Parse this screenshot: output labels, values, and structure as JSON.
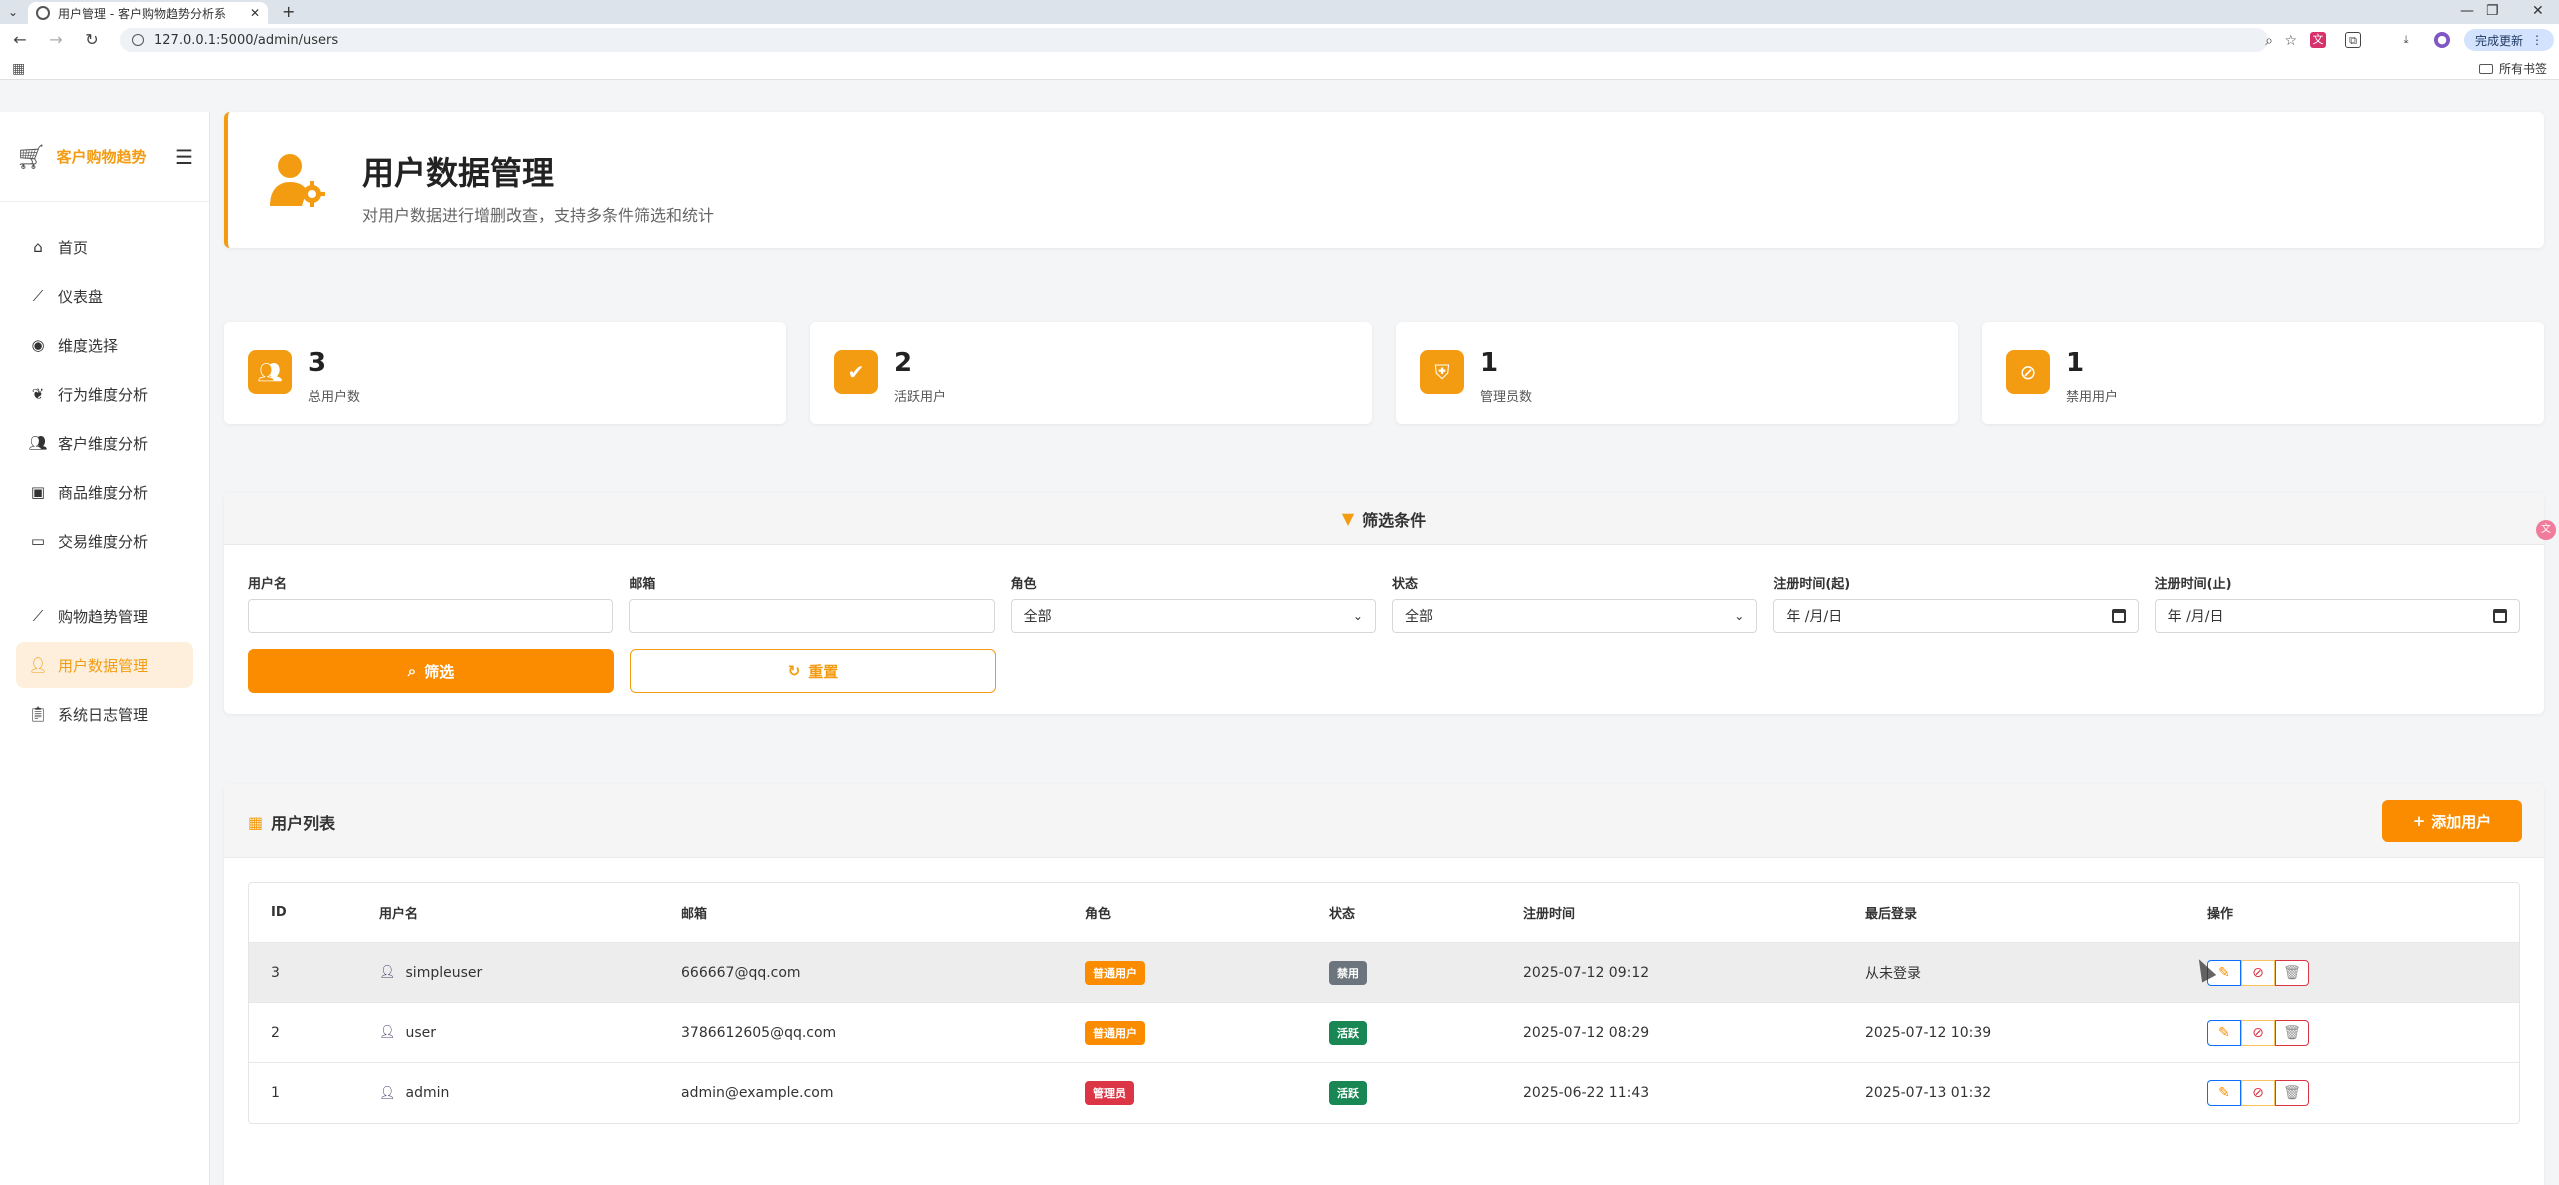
{
  "browser": {
    "tab_title": "用户管理 - 客户购物趋势分析系",
    "url": "127.0.0.1:5000/admin/users",
    "update_label": "完成更新",
    "all_bookmarks": "所有书签"
  },
  "sidebar": {
    "brand": "客户购物趋势",
    "items": [
      {
        "label": "首页",
        "icon": "home-icon"
      },
      {
        "label": "仪表盘",
        "icon": "chart-line-icon"
      },
      {
        "label": "维度选择",
        "icon": "compass-icon"
      },
      {
        "label": "行为维度分析",
        "icon": "brain-icon"
      },
      {
        "label": "客户维度分析",
        "icon": "users-icon"
      },
      {
        "label": "商品维度分析",
        "icon": "box-icon"
      },
      {
        "label": "交易维度分析",
        "icon": "credit-card-icon"
      },
      {
        "label": "购物趋势管理",
        "icon": "chart-line-icon"
      },
      {
        "label": "用户数据管理",
        "icon": "user-gear-icon",
        "active": true
      },
      {
        "label": "系统日志管理",
        "icon": "clipboard-icon"
      }
    ]
  },
  "header": {
    "title": "用户数据管理",
    "subtitle": "对用户数据进行增删改查，支持多条件筛选和统计"
  },
  "stats": [
    {
      "value": "3",
      "label": "总用户数",
      "icon": "users-icon"
    },
    {
      "value": "2",
      "label": "活跃用户",
      "icon": "user-check-icon"
    },
    {
      "value": "1",
      "label": "管理员数",
      "icon": "user-shield-icon"
    },
    {
      "value": "1",
      "label": "禁用用户",
      "icon": "user-slash-icon"
    }
  ],
  "filter": {
    "title": "筛选条件",
    "fields": {
      "username_label": "用户名",
      "email_label": "邮箱",
      "role_label": "角色",
      "role_value": "全部",
      "status_label": "状态",
      "status_value": "全部",
      "reg_start_label": "注册时间(起)",
      "reg_start_value": "年 /月/日",
      "reg_end_label": "注册时间(止)",
      "reg_end_value": "年 /月/日"
    },
    "filter_button": "筛选",
    "reset_button": "重置"
  },
  "list": {
    "title": "用户列表",
    "add_button": "添加用户",
    "columns": [
      "ID",
      "用户名",
      "邮箱",
      "角色",
      "状态",
      "注册时间",
      "最后登录",
      "操作"
    ],
    "rows": [
      {
        "id": "3",
        "username": "simpleuser",
        "email": "666667@qq.com",
        "role": "普通用户",
        "role_color": "#fb8c00",
        "status": "禁用",
        "status_color": "#6c757d",
        "registered": "2025-07-12 09:12",
        "last_login": "从未登录"
      },
      {
        "id": "2",
        "username": "user",
        "email": "3786612605@qq.com",
        "role": "普通用户",
        "role_color": "#fb8c00",
        "status": "活跃",
        "status_color": "#198754",
        "registered": "2025-07-12 08:29",
        "last_login": "2025-07-12 10:39"
      },
      {
        "id": "1",
        "username": "admin",
        "email": "admin@example.com",
        "role": "管理员",
        "role_color": "#dc3545",
        "status": "活跃",
        "status_color": "#198754",
        "registered": "2025-06-22 11:43",
        "last_login": "2025-07-13 01:32"
      }
    ]
  },
  "colors": {
    "accent": "#f39c12",
    "primary_button": "#fb8c00"
  }
}
